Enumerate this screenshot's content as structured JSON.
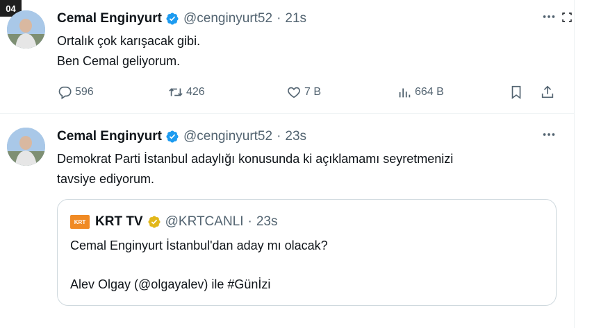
{
  "corner_label": "04",
  "tweets": [
    {
      "name": "Cemal Enginyurt",
      "handle": "@cenginyurt52",
      "time": "21s",
      "text": "Ortalık çok karışacak gibi.\nBen Cemal geliyorum.",
      "replies": "596",
      "retweets": "426",
      "likes": "7 B",
      "views": "664 B"
    },
    {
      "name": "Cemal Enginyurt",
      "handle": "@cenginyurt52",
      "time": "23s",
      "text": "Demokrat Parti İstanbul adaylığı konusunda ki açıklamamı seyretmenizi\ntavsiye ediyorum.",
      "quote": {
        "logo_text": "KRT",
        "name": "KRT TV",
        "handle": "@KRTCANLI",
        "time": "23s",
        "text": "Cemal Enginyurt İstanbul'dan aday mı olacak?\n\nAlev Olgay (@olgayalev) ile #Günİzi"
      }
    }
  ],
  "separator": "·",
  "colors": {
    "text": "#0f1419",
    "secondary": "#536471",
    "verified_blue": "#1d9bf0",
    "verified_gold": "#e2b719",
    "border": "#cfd9de"
  },
  "icons": [
    "verified-badge-icon",
    "more-icon",
    "expand-icon",
    "reply-icon",
    "retweet-icon",
    "like-icon",
    "views-icon",
    "bookmark-icon",
    "share-icon",
    "gold-verified-badge-icon"
  ]
}
